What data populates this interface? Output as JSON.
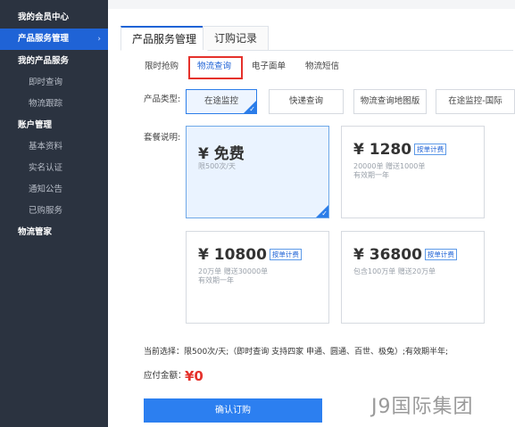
{
  "sidebar": {
    "items": [
      {
        "label": "我的会员中心",
        "kind": "head"
      },
      {
        "label": "产品服务管理",
        "kind": "active",
        "arrow": "›"
      },
      {
        "label": "我的产品服务",
        "kind": "head"
      },
      {
        "label": "即时查询",
        "kind": "sub"
      },
      {
        "label": "物流跟踪",
        "kind": "sub"
      },
      {
        "label": "账户管理",
        "kind": "head"
      },
      {
        "label": "基本资料",
        "kind": "sub"
      },
      {
        "label": "实名认证",
        "kind": "sub"
      },
      {
        "label": "通知公告",
        "kind": "sub"
      },
      {
        "label": "已购服务",
        "kind": "sub"
      },
      {
        "label": "物流管家",
        "kind": "head"
      }
    ]
  },
  "tabs": [
    "产品服务管理",
    "订购记录"
  ],
  "subtabs": [
    "限时抢购",
    "物流查询",
    "电子面单",
    "物流短信"
  ],
  "labels": {
    "product_type": "产品类型:",
    "plan_desc": "套餐说明:"
  },
  "product_types": [
    "在途监控",
    "快递查询",
    "物流查询地图版",
    "在途监控-国际"
  ],
  "plans": [
    {
      "currency": "¥",
      "price": "免费",
      "badge": "",
      "line1": "限500次/天",
      "line2": ""
    },
    {
      "currency": "¥",
      "price": "1280",
      "badge": "按单计费",
      "line1": "20000单  赠送1000单",
      "line2": "有效期一年"
    },
    {
      "currency": "¥",
      "price": "10800",
      "badge": "按单计费",
      "line1": "20万单  赠送30000单",
      "line2": "有效期一年"
    },
    {
      "currency": "¥",
      "price": "36800",
      "badge": "按单计费",
      "line1": "包含100万单  赠送20万单",
      "line2": ""
    }
  ],
  "current_selection": "当前选择：限500次/天;（即时查询 支持四家 申通、圆通、百世、极兔）;有效期半年;",
  "payable_label": "应付金额：",
  "payable_value": "¥0",
  "confirm_label": "确认订购",
  "watermark": "J9国际集团",
  "colors": {
    "sidebar_bg": "#2b3340",
    "accent": "#1f63d6",
    "button": "#2c7ff0",
    "highlight_box": "#e5312b"
  }
}
